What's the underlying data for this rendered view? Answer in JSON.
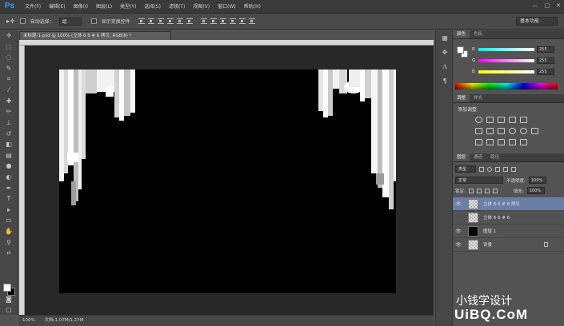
{
  "app": {
    "logo": "Ps"
  },
  "menu": [
    "文件(F)",
    "编辑(E)",
    "图像(I)",
    "图层(L)",
    "类型(Y)",
    "选择(S)",
    "滤镜(T)",
    "视图(V)",
    "窗口(W)",
    "帮助(H)"
  ],
  "window_controls": [
    "—",
    "□",
    "✕"
  ],
  "options": {
    "auto_select_label": "自动选择：",
    "auto_select_value": "组",
    "show_transform_label": "显示变换控件",
    "workspace": "基本功能"
  },
  "document": {
    "tab_title": "未标题-1.psd @ 100% (立体 6  6  # 6 拷贝, RGB/8) *",
    "zoom": "100%",
    "doc_info": "文档:1.07M/1.27M"
  },
  "color_panel": {
    "tabs": [
      "颜色",
      "色板"
    ],
    "channels": [
      {
        "label": "R",
        "value": "255"
      },
      {
        "label": "G",
        "value": "255"
      },
      {
        "label": "B",
        "value": "255"
      }
    ]
  },
  "adjust_panel": {
    "tabs": [
      "调整",
      "样式"
    ],
    "title": "添加调整"
  },
  "layers_panel": {
    "tabs": [
      "图层",
      "通道",
      "路径"
    ],
    "filter_kind": "类型",
    "blend_mode": "正常",
    "opacity_label": "不透明度:",
    "opacity_value": "100%",
    "lock_label": "锁定:",
    "fill_label": "填充:",
    "fill_value": "100%",
    "layers": [
      {
        "name": "立体 6  6  # 6 拷贝",
        "selected": true,
        "visible": true,
        "thumb": "checker",
        "locked": false
      },
      {
        "name": "立体 6  6  # 6",
        "selected": false,
        "visible": false,
        "thumb": "checker",
        "locked": false
      },
      {
        "name": "图层 1",
        "selected": false,
        "visible": true,
        "thumb": "black",
        "locked": false
      },
      {
        "name": "背景",
        "selected": false,
        "visible": true,
        "thumb": "checker",
        "locked": true
      }
    ]
  },
  "watermark": {
    "line1": "小钱学设计",
    "line2": "UiBQ.CoM"
  },
  "colors": {
    "selection": "#6b7fa6",
    "canvas": "#000000"
  }
}
